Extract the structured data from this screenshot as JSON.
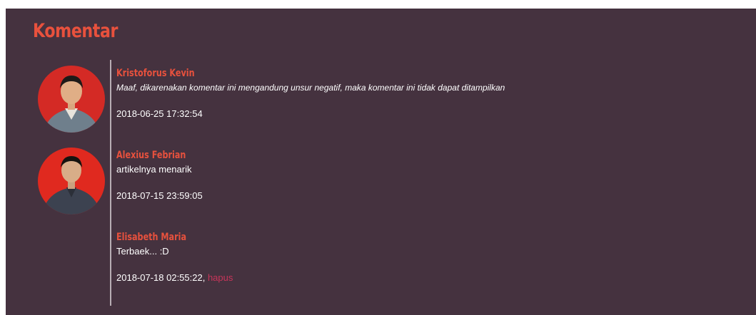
{
  "title": "Komentar",
  "comments": [
    {
      "author": "Kristoforus Kevin",
      "text": "Maaf, dikarenakan komentar ini mengandung unsur negatif, maka komentar ini tidak dapat ditampilkan",
      "date": "2018-06-25 17:32:54"
    },
    {
      "author": "Alexius Febrian",
      "text": "artikelnya menarik",
      "date": "2018-07-15 23:59:05"
    },
    {
      "author": "Elisabeth Maria",
      "text": "Terbaek... :D",
      "date": "2018-07-18 02:55:22,",
      "delete_label": "hapus"
    }
  ],
  "colors": {
    "background": "#45323f",
    "accent": "#e8513d",
    "delete_link": "#c8355a"
  }
}
